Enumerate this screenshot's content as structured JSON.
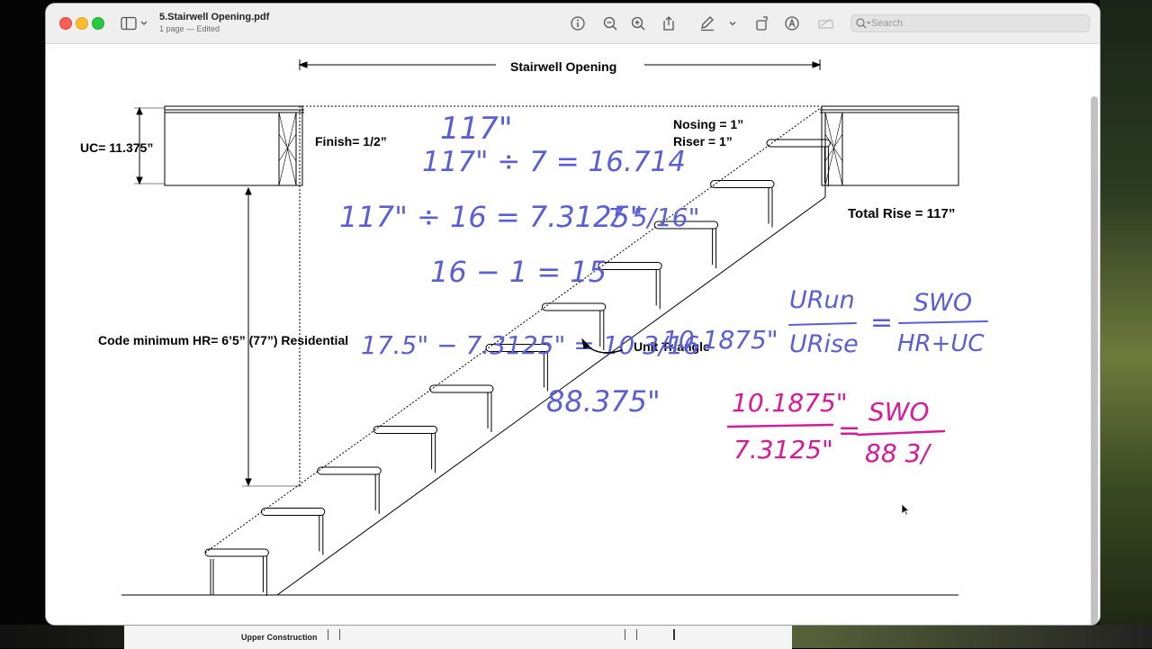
{
  "window": {
    "filename": "5.Stairwell Opening.pdf",
    "subtitle": "1 page — Edited",
    "search_placeholder": "Search"
  },
  "toolbar_icons": [
    "info-icon",
    "zoom-out-icon",
    "zoom-in-icon",
    "share-icon",
    "markup-pen-icon",
    "chevron-down-icon",
    "rotate-icon",
    "markup-circle-icon",
    "annotate-icon"
  ],
  "drawing": {
    "stairwell_opening": "Stairwell Opening",
    "uc": "UC= 11.375”",
    "finish": "Finish= 1/2”",
    "nosing": "Nosing = 1”",
    "riser": "Riser = 1”",
    "total_rise": "Total Rise = 117”",
    "code_min_hr": "Code minimum HR= 6’5” (77”) Residential",
    "unit_triangle": "Unit Triangle"
  },
  "handwriting": {
    "blue": {
      "line1": "117\"",
      "line2": "117\" ÷ 7 = 16.714",
      "line3": "117\" ÷ 16 = 7.3125\"",
      "line3b": "7 5/16\"",
      "line4": "16 − 1 = 15",
      "line5a": "17.5\" − 7.3125\" = 10 3/16",
      "line5b": "10.1875\"",
      "line6": "88.375\"",
      "fraction_run": "URun",
      "fraction_rise": "URise",
      "equals": "=",
      "fraction_swo": "SWO",
      "fraction_hruc": "HR+UC"
    },
    "pink": {
      "num_left": "10.1875\"",
      "den_left": "7.3125\"",
      "equals": "=",
      "num_right": "SWO",
      "den_right": "88 3/"
    }
  },
  "background_window": {
    "label": "Upper Construction"
  },
  "colors": {
    "handwriting_blue": "#5a5fd8",
    "handwriting_pink": "#d8199a",
    "close": "#fe5f57",
    "minimize": "#febc2e",
    "maximize": "#28c840"
  }
}
